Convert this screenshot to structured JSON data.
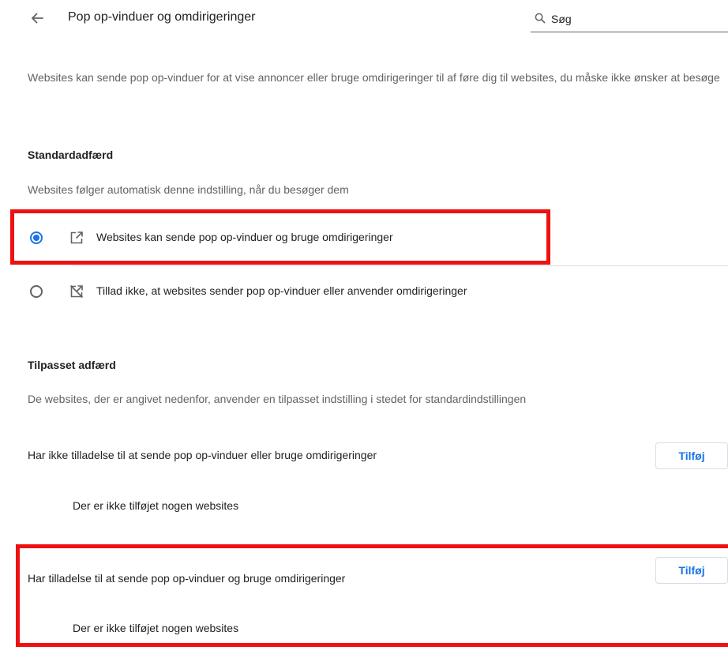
{
  "header": {
    "title": "Pop op-vinduer og omdirigeringer",
    "back_icon": "arrow-back-icon",
    "search": {
      "value": "Søg",
      "icon": "search-icon"
    }
  },
  "description": "Websites kan sende pop op-vinduer for at vise annoncer eller bruge omdirigeringer til af føre dig til websites, du måske ikke ønsker at besøge",
  "default_behavior": {
    "heading": "Standardadfærd",
    "subtext": "Websites følger automatisk denne indstilling, når du besøger dem",
    "options": [
      {
        "label": "Websites kan sende pop op-vinduer og bruge omdirigeringer",
        "selected": true,
        "icon": "open-in-new-icon"
      },
      {
        "label": "Tillad ikke, at websites sender pop op-vinduer eller anvender omdirigeringer",
        "selected": false,
        "icon": "open-in-new-off-icon"
      }
    ]
  },
  "custom_behavior": {
    "heading": "Tilpasset adfærd",
    "subtext": "De websites, der er angivet nedenfor, anvender en tilpasset indstilling i stedet for standardindstillingen",
    "blocked": {
      "label": "Har ikke tilladelse til at sende pop op-vinduer eller bruge omdirigeringer",
      "add_label": "Tilføj",
      "empty_text": "Der er ikke tilføjet nogen websites"
    },
    "allowed": {
      "label": "Har tilladelse til at sende pop op-vinduer og bruge omdirigeringer",
      "add_label": "Tilføj",
      "empty_text": "Der er ikke tilføjet nogen websites"
    }
  },
  "colors": {
    "accent": "#1a73e8",
    "highlight": "#ee1111",
    "secondary_text": "#5f6368",
    "divider": "#dadce0"
  }
}
